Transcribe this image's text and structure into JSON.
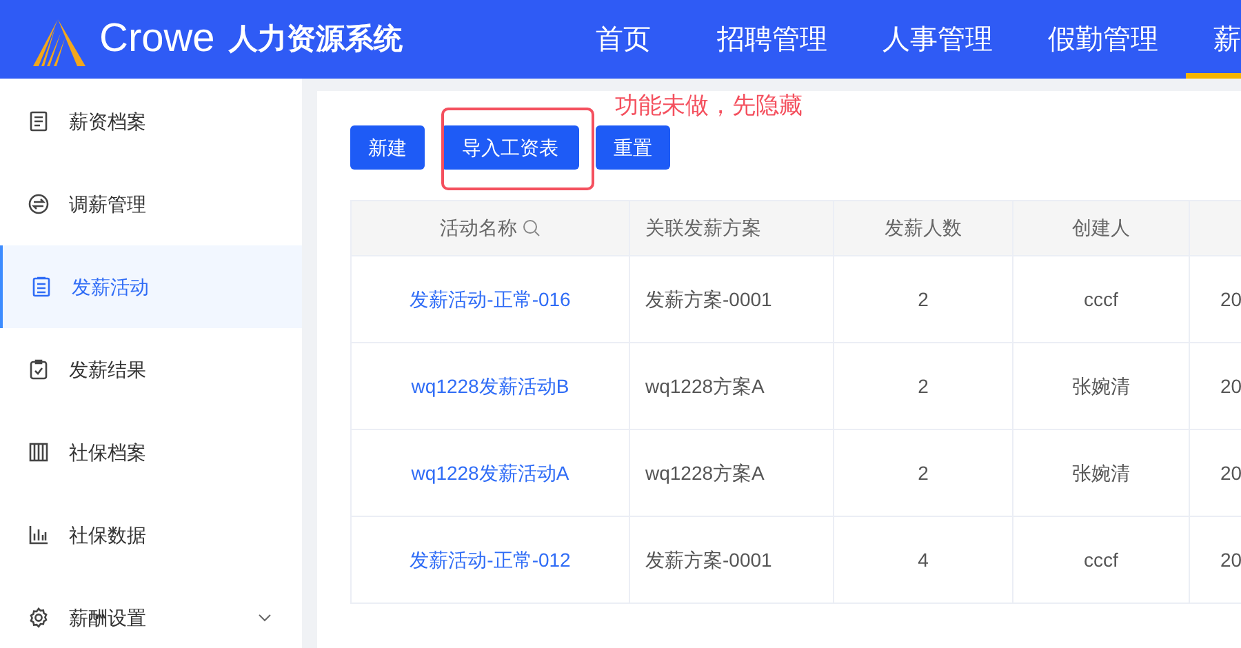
{
  "header": {
    "logo_text": "Crowe",
    "system_title": "人力资源系统"
  },
  "nav": [
    {
      "label": "首页",
      "selected": false
    },
    {
      "label": "招聘管理",
      "selected": false
    },
    {
      "label": "人事管理",
      "selected": false
    },
    {
      "label": "假勤管理",
      "selected": false
    },
    {
      "label": "薪",
      "selected": true
    }
  ],
  "sidebar": {
    "items": [
      {
        "label": "薪资档案",
        "kind": "file",
        "selected": false
      },
      {
        "label": "调薪管理",
        "kind": "swap",
        "selected": false
      },
      {
        "label": "发薪活动",
        "kind": "list",
        "selected": true
      },
      {
        "label": "发薪结果",
        "kind": "clipboard",
        "selected": false
      },
      {
        "label": "社保档案",
        "kind": "columns",
        "selected": false
      },
      {
        "label": "社保数据",
        "kind": "chart",
        "selected": false
      },
      {
        "label": "薪酬设置",
        "kind": "gear",
        "selected": false,
        "expandable": true
      }
    ]
  },
  "toolbar": {
    "buttons": [
      "新建",
      "导入工资表",
      "重置"
    ],
    "annotation": "功能未做，先隐藏"
  },
  "table": {
    "columns": [
      {
        "label": "活动名称",
        "searchable": true
      },
      {
        "label": "关联发薪方案",
        "searchable": false
      },
      {
        "label": "发薪人数",
        "searchable": false
      },
      {
        "label": "创建人",
        "searchable": false
      },
      {
        "searchable": false
      }
    ],
    "rows": [
      {
        "name": "发薪活动-正常-016",
        "plan": "发薪方案-0001",
        "count": "2",
        "creator": "cccf",
        "column_5": "20"
      },
      {
        "name": "wq1228发薪活动B",
        "plan": "wq1228方案A",
        "count": "2",
        "creator": "张婉清",
        "column_5": "20"
      },
      {
        "name": "wq1228发薪活动A",
        "plan": "wq1228方案A",
        "count": "2",
        "creator": "张婉清",
        "column_5": "20"
      },
      {
        "name": "发薪活动-正常-012",
        "plan": "发薪方案-0001",
        "count": "4",
        "creator": "cccf",
        "column_5": "20"
      }
    ]
  }
}
